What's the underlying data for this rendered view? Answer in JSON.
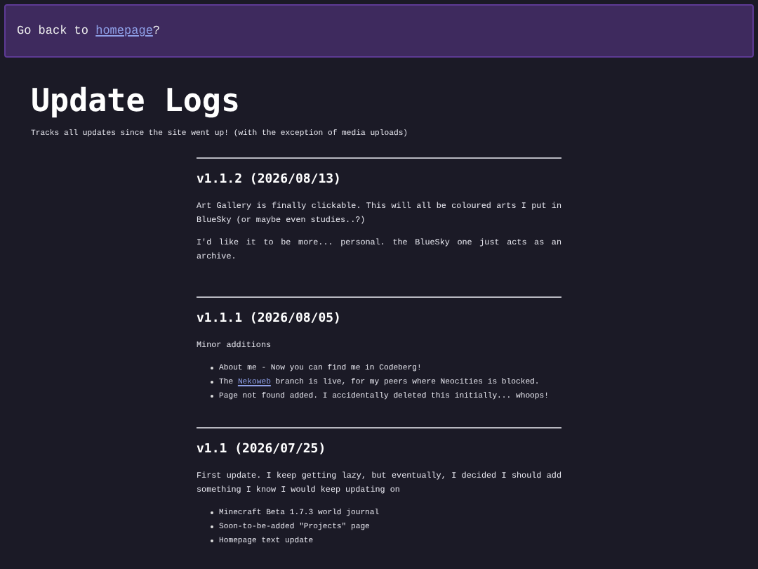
{
  "banner": {
    "before": "Go back to ",
    "link": "homepage",
    "after": "?"
  },
  "title": "Update Logs",
  "subtitle": "Tracks all updates since the site went up! (with the exception of media uploads)",
  "entries": [
    {
      "heading": "v1.1.2 (2026/08/13)",
      "paragraphs": [
        "Art Gallery is finally clickable. This will all be coloured arts I put in BlueSky (or maybe even studies..?)",
        "I'd like it to be more... personal. the BlueSky one just acts as an archive."
      ]
    },
    {
      "heading": "v1.1.1 (2026/08/05)",
      "paragraphs": [
        "Minor additions"
      ],
      "items": [
        {
          "before": "About me - Now you can find me in Codeberg!"
        },
        {
          "before": "The ",
          "link": "Nekoweb",
          "after": " branch is live, for my peers where Neocities is blocked."
        },
        {
          "before": "Page not found added. I accidentally deleted this initially... whoops!"
        }
      ]
    },
    {
      "heading": "v1.1 (2026/07/25)",
      "paragraphs": [
        "First update. I keep getting lazy, but eventually, I decided I should add something I know I would keep updating on"
      ],
      "items": [
        {
          "before": "Minecraft Beta 1.7.3 world journal"
        },
        {
          "before": "Soon-to-be-added \"Projects\" page"
        },
        {
          "before": "Homepage text update"
        }
      ]
    }
  ]
}
